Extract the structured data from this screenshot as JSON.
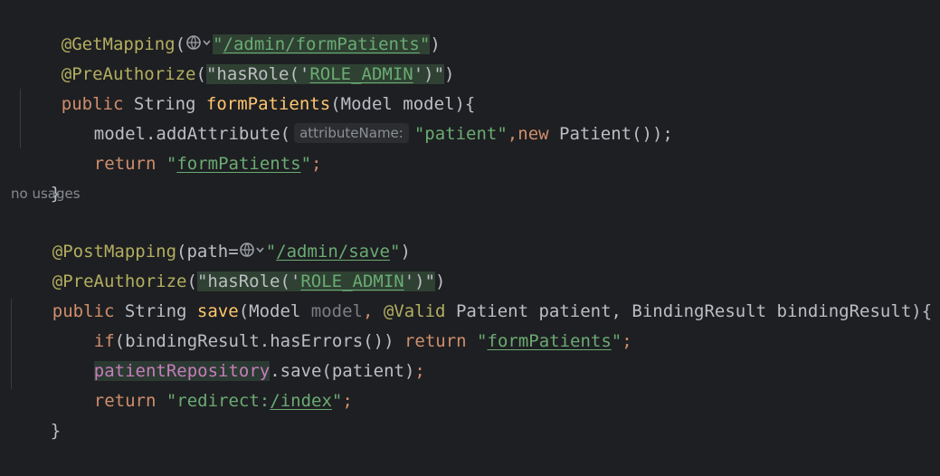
{
  "editor": {
    "lines": [
      {
        "tokens": [
          "@GetMapping",
          "(",
          "\"",
          "/admin/formPatients",
          "\"",
          ")"
        ]
      },
      {
        "tokens": [
          "@PreAuthorize",
          "(",
          "\"hasRole('",
          "ROLE_ADMIN",
          "')\"",
          ")"
        ]
      },
      {
        "tokens": [
          "public",
          " String ",
          "formPatients",
          "(Model model){"
        ]
      },
      {
        "tokens": [
          "model.addAttribute(",
          "attributeName:",
          "\"patient\"",
          ",",
          "new",
          " Patient());"
        ]
      },
      {
        "tokens": [
          "return",
          " ",
          "\"",
          "formPatients",
          "\"",
          ";"
        ]
      },
      {
        "tokens": [
          "}"
        ]
      },
      {
        "tokens": [
          "@PostMapping",
          "(path=",
          "\"",
          "/admin/save",
          "\"",
          ")"
        ]
      },
      {
        "tokens": [
          "@PreAuthorize",
          "(",
          "\"hasRole('",
          "ROLE_ADMIN",
          "')\"",
          ")"
        ]
      },
      {
        "tokens": [
          "public",
          " String ",
          "save",
          "(Model ",
          "model",
          ", ",
          "@Valid",
          " Patient patient, BindingResult bindingResult){"
        ]
      },
      {
        "tokens": [
          "if",
          "(bindingResult.hasErrors()) ",
          "return",
          " ",
          "\"",
          "formPatients",
          "\"",
          ";"
        ]
      },
      {
        "tokens": [
          "patientRepository",
          ".save(patient)",
          ";"
        ]
      },
      {
        "tokens": [
          "return",
          " ",
          "\"redirect:",
          "/index",
          "\"",
          ";"
        ]
      },
      {
        "tokens": [
          "}"
        ]
      }
    ],
    "inlay_usages": "no usages",
    "icons": {
      "web_endpoint": "globe-icon",
      "dropdown": "chevron-down-icon"
    }
  },
  "colors": {
    "background": "#1e1f22",
    "annotation": "#b3ae60",
    "keyword": "#cf8e6d",
    "method_declaration": "#56a8f5",
    "string": "#6aab73",
    "field": "#c77dbb",
    "text": "#bcbec4"
  }
}
